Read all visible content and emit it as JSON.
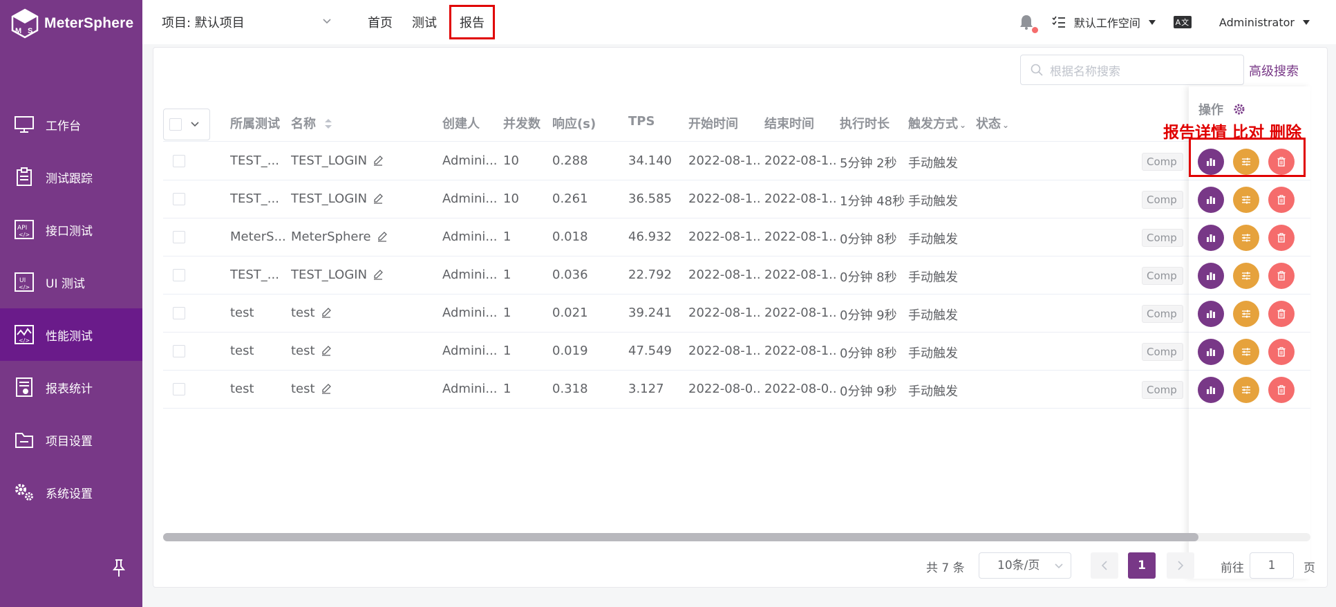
{
  "app": {
    "name": "MeterSphere"
  },
  "sidebar": {
    "items": [
      {
        "label": "工作台",
        "icon": "monitor-icon"
      },
      {
        "label": "测试跟踪",
        "icon": "clipboard-icon"
      },
      {
        "label": "接口测试",
        "icon": "api-icon"
      },
      {
        "label": "UI 测试",
        "icon": "ui-icon"
      },
      {
        "label": "性能测试",
        "icon": "performance-icon"
      },
      {
        "label": "报表统计",
        "icon": "report-stat-icon"
      },
      {
        "label": "项目设置",
        "icon": "folder-icon"
      },
      {
        "label": "系统设置",
        "icon": "gears-icon"
      }
    ],
    "active_index": 4
  },
  "header": {
    "project_label": "项目: 默认项目",
    "nav": [
      "首页",
      "测试",
      "报告"
    ],
    "active_nav": "报告",
    "workspace": "默认工作空间",
    "lang_badge": "A文",
    "user": "Administrator"
  },
  "search": {
    "placeholder": "根据名称搜索",
    "advanced_label": "高级搜索"
  },
  "table": {
    "columns": [
      "所属测试",
      "名称",
      "创建人",
      "并发数",
      "响应(s)",
      "TPS",
      "开始时间",
      "结束时间",
      "执行时长",
      "触发方式",
      "状态",
      "操作"
    ],
    "rows": [
      {
        "test": "TEST_...",
        "name": "TEST_LOGIN",
        "creator": "Admini...",
        "concurrency": "10",
        "response": "0.288",
        "tps": "34.140",
        "start": "2022-08-1...",
        "end": "2022-08-1...",
        "duration": "5分钟 2秒",
        "trigger": "手动触发",
        "status": "Comp"
      },
      {
        "test": "TEST_...",
        "name": "TEST_LOGIN",
        "creator": "Admini...",
        "concurrency": "10",
        "response": "0.261",
        "tps": "36.585",
        "start": "2022-08-1...",
        "end": "2022-08-1...",
        "duration": "1分钟 48秒",
        "trigger": "手动触发",
        "status": "Comp"
      },
      {
        "test": "MeterS...",
        "name": "MeterSphere",
        "creator": "Admini...",
        "concurrency": "1",
        "response": "0.018",
        "tps": "46.932",
        "start": "2022-08-1...",
        "end": "2022-08-1...",
        "duration": "0分钟 8秒",
        "trigger": "手动触发",
        "status": "Comp"
      },
      {
        "test": "TEST_...",
        "name": "TEST_LOGIN",
        "creator": "Admini...",
        "concurrency": "1",
        "response": "0.036",
        "tps": "22.792",
        "start": "2022-08-1...",
        "end": "2022-08-1...",
        "duration": "0分钟 8秒",
        "trigger": "手动触发",
        "status": "Comp"
      },
      {
        "test": "test",
        "name": "test",
        "creator": "Admini...",
        "concurrency": "1",
        "response": "0.021",
        "tps": "39.241",
        "start": "2022-08-1...",
        "end": "2022-08-1...",
        "duration": "0分钟 9秒",
        "trigger": "手动触发",
        "status": "Comp"
      },
      {
        "test": "test",
        "name": "test",
        "creator": "Admini...",
        "concurrency": "1",
        "response": "0.019",
        "tps": "47.549",
        "start": "2022-08-1...",
        "end": "2022-08-1...",
        "duration": "0分钟 8秒",
        "trigger": "手动触发",
        "status": "Comp"
      },
      {
        "test": "test",
        "name": "test",
        "creator": "Admini...",
        "concurrency": "1",
        "response": "0.318",
        "tps": "3.127",
        "start": "2022-08-0...",
        "end": "2022-08-0...",
        "duration": "0分钟 9秒",
        "trigger": "手动触发",
        "status": "Comp"
      }
    ]
  },
  "annotation": {
    "text": "报告详情 比对 删除"
  },
  "pagination": {
    "total": "共 7 条",
    "page_size": "10条/页",
    "current_page": "1",
    "goto_label": "前往",
    "goto_value": "1",
    "page_unit": "页"
  },
  "colors": {
    "brand": "#783887",
    "compare": "#e6a23c",
    "delete": "#f56c6c",
    "annotation": "#e00000"
  }
}
